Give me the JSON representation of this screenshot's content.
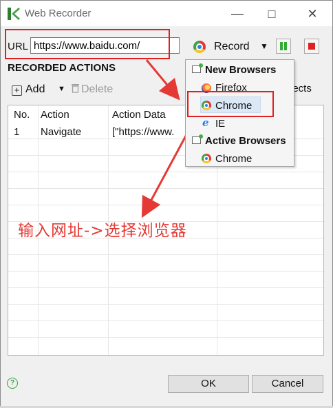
{
  "window": {
    "title": "Web Recorder"
  },
  "url_bar": {
    "label": "URL",
    "value": "https://www.baidu.com/"
  },
  "toolbar": {
    "record_label": "Record"
  },
  "section": {
    "title": "RECORDED ACTIONS"
  },
  "actions_bar": {
    "add_label": "Add",
    "delete_label": "Delete",
    "objects_partial": "jects"
  },
  "table": {
    "columns": [
      "No.",
      "Action",
      "Action Data"
    ],
    "rows": [
      {
        "no": "1",
        "action": "Navigate",
        "data": "[\"https://www."
      }
    ]
  },
  "dropdown": {
    "new_browsers_header": "New Browsers",
    "items_new": [
      "Firefox",
      "Chrome",
      "IE"
    ],
    "active_browsers_header": "Active Browsers",
    "items_active": [
      "Chrome"
    ]
  },
  "annotation": {
    "text": "输入网址->选择浏览器",
    "color": "#e53935"
  },
  "footer": {
    "ok_label": "OK",
    "cancel_label": "Cancel"
  },
  "colors": {
    "highlight_box": "#e02020",
    "selection": "#dbe8f6"
  }
}
